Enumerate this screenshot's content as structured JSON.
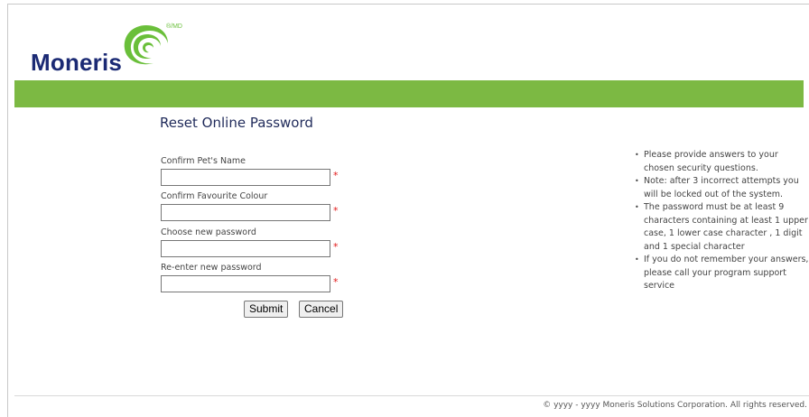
{
  "logo": {
    "text": "Moneris",
    "reg_mark": "®/MD"
  },
  "page": {
    "title": "Reset Online Password"
  },
  "form": {
    "fields": [
      {
        "label": "Confirm Pet's Name",
        "value": "",
        "required_mark": "*"
      },
      {
        "label": "Confirm Favourite Colour",
        "value": "",
        "required_mark": "*"
      },
      {
        "label": "Choose new password",
        "value": "",
        "required_mark": "*"
      },
      {
        "label": "Re-enter new password",
        "value": "",
        "required_mark": "*"
      }
    ],
    "submit_label": "Submit",
    "cancel_label": "Cancel"
  },
  "notes": [
    "Please provide answers to your chosen security questions.",
    "Note: after 3 incorrect attempts you will be locked out of the system.",
    "The password must be at least 9 characters containing at least 1 upper case, 1 lower case character , 1 digit and 1 special character",
    "If you do not remember your answers, please call your program support service"
  ],
  "footer": {
    "text": "© yyyy - yyyy  Moneris Solutions Corporation. All rights reserved."
  },
  "colors": {
    "brand_green": "#7cb943",
    "brand_navy": "#1b2a74",
    "required_red": "#e21b1b"
  }
}
